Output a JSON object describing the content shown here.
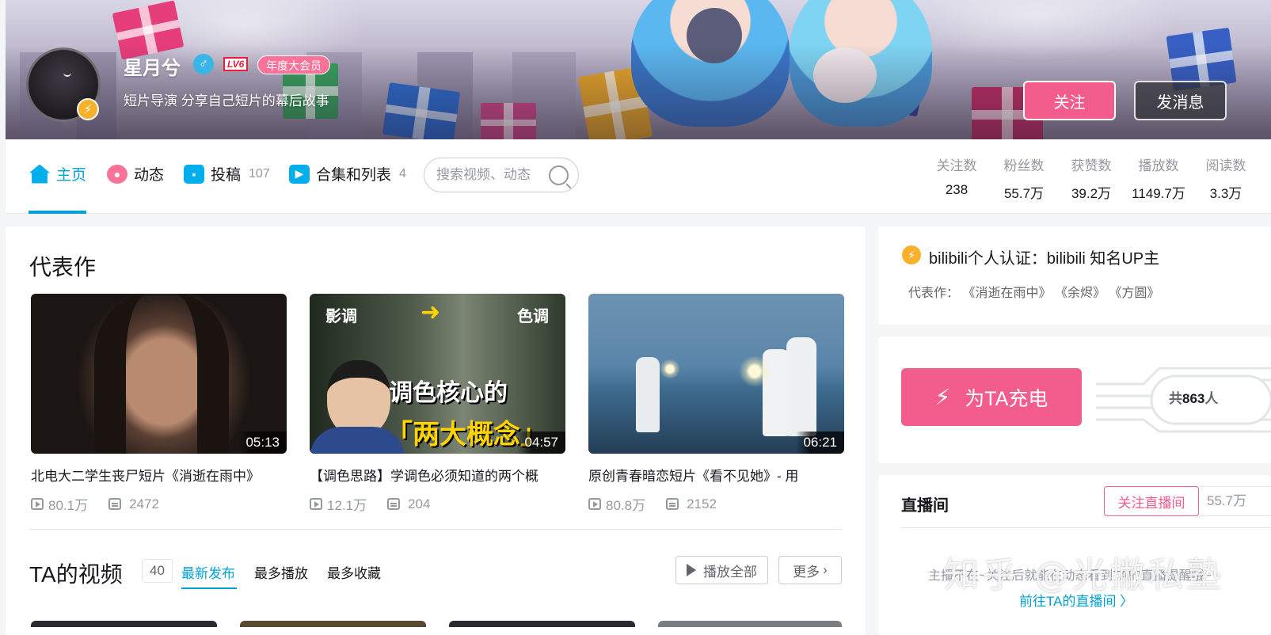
{
  "header": {
    "username": "星月兮",
    "level": "LV6",
    "vip_label": "年度大会员",
    "sign": "短片导演 分享自己短片的幕后故事",
    "follow_label": "关注",
    "message_label": "发消息"
  },
  "nav": {
    "tabs": [
      {
        "label": "主页",
        "count": ""
      },
      {
        "label": "动态",
        "count": ""
      },
      {
        "label": "投稿",
        "count": "107"
      },
      {
        "label": "合集和列表",
        "count": "4"
      }
    ],
    "search_placeholder": "搜索视频、动态",
    "stats": [
      {
        "label": "关注数",
        "value": "238"
      },
      {
        "label": "粉丝数",
        "value": "55.7万"
      },
      {
        "label": "获赞数",
        "value": "39.2万"
      },
      {
        "label": "播放数",
        "value": "1149.7万"
      },
      {
        "label": "阅读数",
        "value": "3.3万"
      }
    ]
  },
  "masterpiece": {
    "title": "代表作",
    "videos": [
      {
        "title": "北电大二学生丧尸短片《消逝在雨中》",
        "duration": "05:13",
        "plays": "80.1万",
        "danmaku": "2472"
      },
      {
        "title": "【调色思路】学调色必须知道的两个概",
        "duration": "04:57",
        "plays": "12.1万",
        "danmaku": "204",
        "thumb_text_left": "影调",
        "thumb_text_right": "色调",
        "thumb_text_line1": "调色核心的",
        "thumb_text_line2": "「两大概念」"
      },
      {
        "title": "原创青春暗恋短片《看不见她》- 用",
        "duration": "06:21",
        "plays": "80.8万",
        "danmaku": "2152"
      }
    ]
  },
  "ta_videos": {
    "title": "TA的视频",
    "count": "40",
    "sorts": [
      "最新发布",
      "最多播放",
      "最多收藏"
    ],
    "play_all": "播放全部",
    "more": "更多"
  },
  "side": {
    "cert": "bilibili个人认证：bilibili 知名UP主",
    "rep_prefix": "代表作：",
    "rep_works": [
      "《消逝在雨中》",
      "《余烬》",
      "《方圆》"
    ],
    "charge_label": "为TA充电",
    "charge_prefix": "共",
    "charge_count": "863",
    "charge_suffix": "人",
    "live_title": "直播间",
    "follow_live": "关注直播间",
    "live_fans": "55.7万",
    "live_msg": "主播不在~关注后就能在动态看到TA的直播提醒哦~",
    "live_link": "前往TA的直播间 〉"
  },
  "watermark": "知乎 @光撇私塾",
  "colors": {
    "pink": "#f25d8e",
    "blue": "#00a1d6",
    "vip": "#fb7299"
  }
}
